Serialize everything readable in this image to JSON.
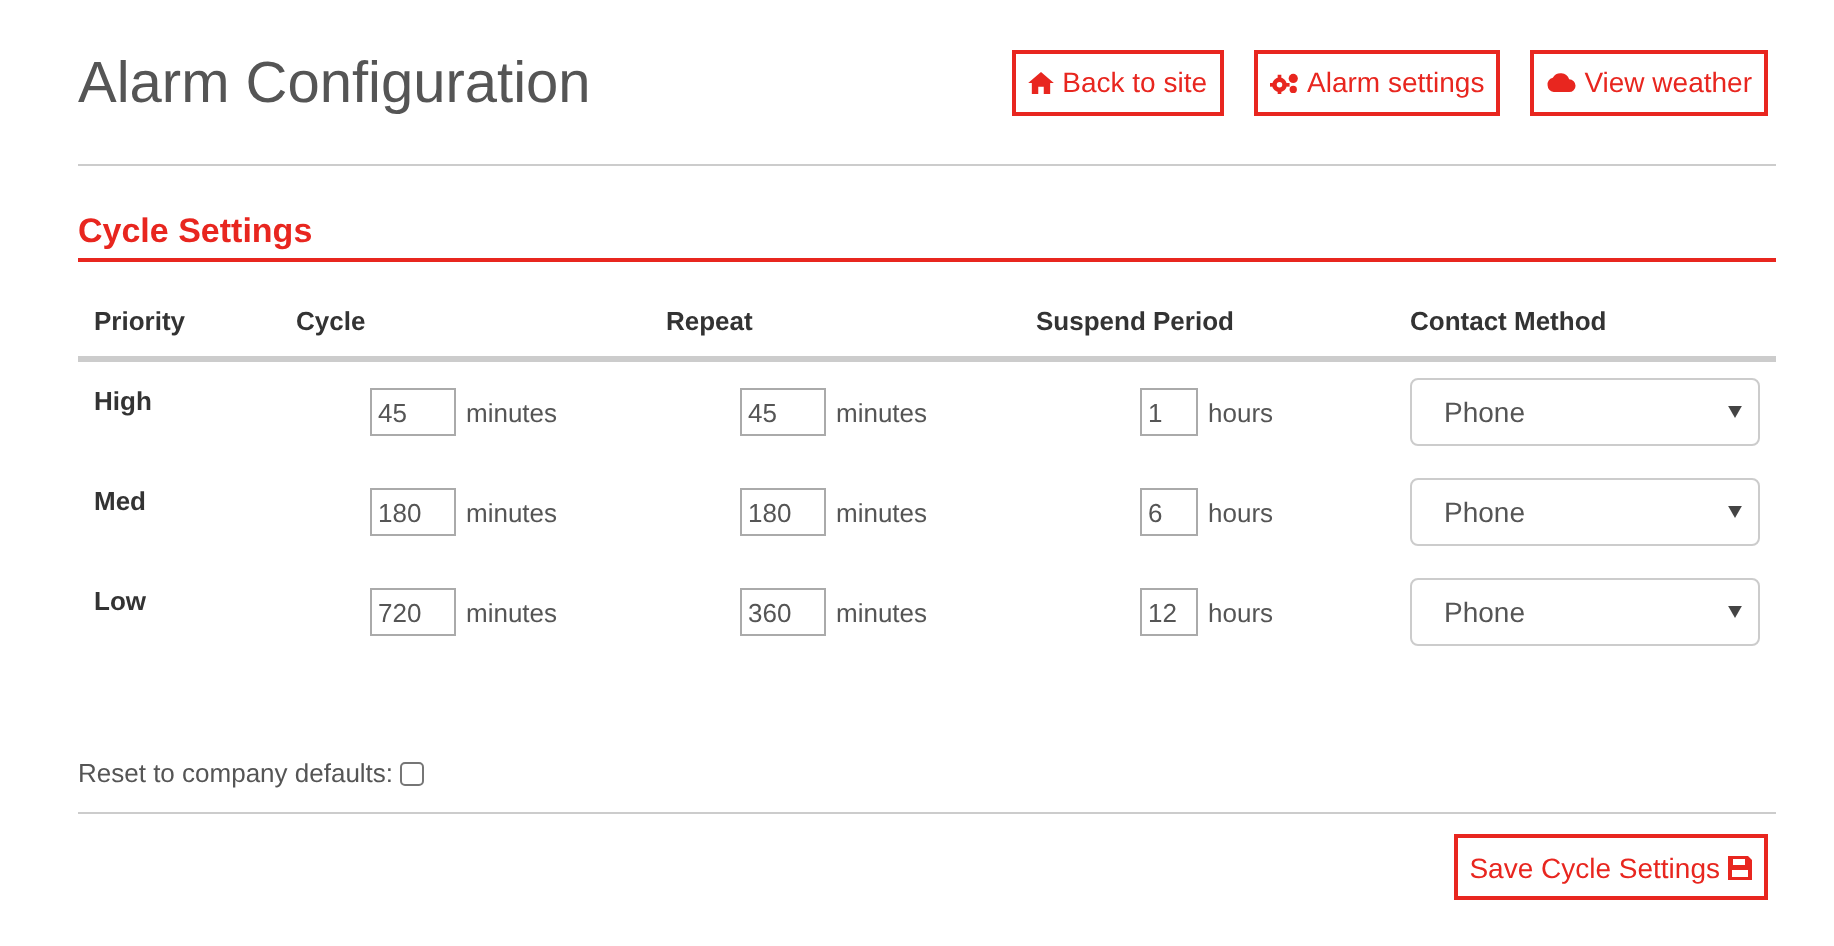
{
  "title": "Alarm Configuration",
  "nav_buttons": [
    {
      "kind": "home",
      "label": "Back to site"
    },
    {
      "kind": "gears",
      "label": "Alarm settings"
    },
    {
      "kind": "cloud",
      "label": "View weather"
    }
  ],
  "section_title": "Cycle Settings",
  "table": {
    "columns": [
      "Priority",
      "Cycle",
      "Repeat",
      "Suspend Period",
      "Contact Method"
    ],
    "rows": [
      {
        "priority": "High",
        "cycle": "45",
        "cycle_unit": "minutes",
        "repeat": "45",
        "repeat_unit": "minutes",
        "suspend": "1",
        "suspend_unit": "hours",
        "contact": "Phone"
      },
      {
        "priority": "Med",
        "cycle": "180",
        "cycle_unit": "minutes",
        "repeat": "180",
        "repeat_unit": "minutes",
        "suspend": "6",
        "suspend_unit": "hours",
        "contact": "Phone"
      },
      {
        "priority": "Low",
        "cycle": "720",
        "cycle_unit": "minutes",
        "repeat": "360",
        "repeat_unit": "minutes",
        "suspend": "12",
        "suspend_unit": "hours",
        "contact": "Phone"
      }
    ]
  },
  "reset": {
    "label": "Reset to company defaults:",
    "checked": false
  },
  "save_button": {
    "label": "Save Cycle Settings"
  }
}
